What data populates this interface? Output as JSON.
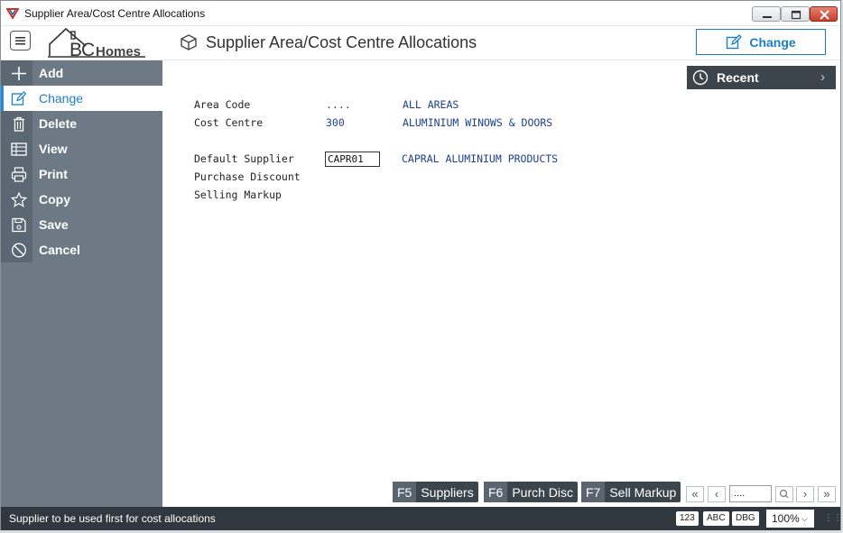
{
  "window": {
    "title": "Supplier Area/Cost Centre Allocations"
  },
  "header": {
    "logo_text_bc": "BC",
    "logo_text_homes": "Homes",
    "page_title": "Supplier Area/Cost Centre Allocations",
    "change_label": "Change"
  },
  "sidebar": {
    "items": [
      {
        "label": "Add",
        "icon": "plus-icon"
      },
      {
        "label": "Change",
        "icon": "edit-icon",
        "active": true
      },
      {
        "label": "Delete",
        "icon": "trash-icon"
      },
      {
        "label": "View",
        "icon": "table-icon"
      },
      {
        "label": "Print",
        "icon": "printer-icon"
      },
      {
        "label": "Copy",
        "icon": "star-icon"
      },
      {
        "label": "Save",
        "icon": "save-icon"
      },
      {
        "label": "Cancel",
        "icon": "cancel-icon"
      }
    ]
  },
  "recent": {
    "label": "Recent"
  },
  "form": {
    "area_code_label": "Area Code",
    "area_code_value": "....",
    "area_code_desc": "ALL AREAS",
    "cost_centre_label": "Cost Centre",
    "cost_centre_value": "300",
    "cost_centre_desc": "ALUMINIUM WINOWS & DOORS",
    "default_supplier_label": "Default Supplier",
    "default_supplier_value": "CAPR01",
    "default_supplier_desc": "CAPRAL ALUMINIUM PRODUCTS",
    "purchase_discount_label": "Purchase Discount",
    "selling_markup_label": "Selling Markup"
  },
  "toolbar": {
    "fkeys": [
      {
        "key": "F5",
        "label": "Suppliers"
      },
      {
        "key": "F6",
        "label": "Purch Disc"
      },
      {
        "key": "F7",
        "label": "Sell Markup"
      }
    ],
    "pager_value": "...."
  },
  "status": {
    "message": "Supplier to be used first for cost allocations",
    "badge_123": "123",
    "badge_abc": "ABC",
    "badge_dbg": "DBG",
    "zoom": "100%"
  },
  "colors": {
    "accent": "#1b7fc4",
    "sidebar": "#6d7a85",
    "statusbar": "#30373e"
  }
}
